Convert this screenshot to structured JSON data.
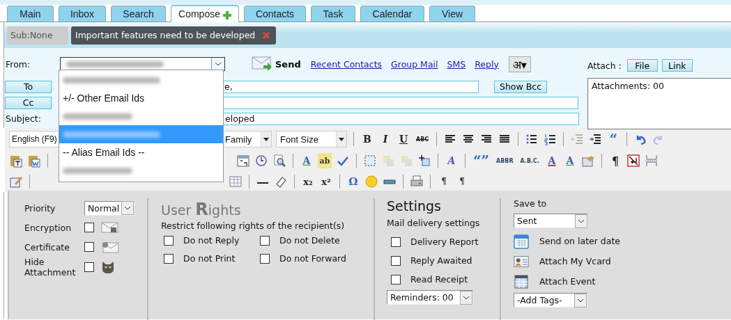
{
  "tabs": [
    {
      "label": "Main",
      "selected": false
    },
    {
      "label": "Inbox",
      "selected": false
    },
    {
      "label": "Search",
      "selected": false
    },
    {
      "label": "Compose",
      "selected": true,
      "add_icon": true
    },
    {
      "label": "Contacts",
      "selected": false
    },
    {
      "label": "Task",
      "selected": false
    },
    {
      "label": "Calendar",
      "selected": false
    },
    {
      "label": "View",
      "selected": false
    }
  ],
  "subject_bar": {
    "sub": "Sub:None",
    "chips": [
      {
        "label": "Important features need to be developed"
      }
    ]
  },
  "compose": {
    "from_label": "From:",
    "from_value_redacted": true,
    "send": "Send",
    "links": [
      "Recent Contacts",
      "Group Mail",
      "SMS",
      "Reply"
    ],
    "script_button": "अ▾",
    "attach_label": "Attach :",
    "attach_buttons": [
      "File",
      "Link"
    ],
    "attachments": "Attachments: 00",
    "to_button": "To",
    "to_value": "e,",
    "show_bcc": "Show Bcc",
    "cc_button": "Cc",
    "subject_label": "Subject:",
    "subject_value": "eloped"
  },
  "from_dropdown": [
    {
      "kind": "redacted",
      "selected": false
    },
    {
      "kind": "option",
      "label": "+/- Other Email Ids",
      "selected": false
    },
    {
      "kind": "redacted",
      "selected": false
    },
    {
      "kind": "redacted",
      "selected": true
    },
    {
      "kind": "option",
      "label": "-- Alias Email Ids --",
      "selected": false
    },
    {
      "kind": "redacted",
      "selected": false
    }
  ],
  "toolbar": [
    [
      {
        "kind": "select",
        "label": "English (F9)"
      },
      {
        "kind": "gap"
      },
      {
        "kind": "select",
        "label": "Family"
      },
      {
        "kind": "select",
        "label": "Font Size"
      },
      {
        "kind": "sep"
      },
      {
        "kind": "bold",
        "label": "B"
      },
      {
        "kind": "italic",
        "label": "I"
      },
      {
        "kind": "underline",
        "label": "U"
      },
      {
        "kind": "strike",
        "label": "ABC"
      },
      {
        "kind": "sep"
      },
      {
        "kind": "align-left"
      },
      {
        "kind": "align-center"
      },
      {
        "kind": "align-right"
      },
      {
        "kind": "align-justify"
      },
      {
        "kind": "sep"
      },
      {
        "kind": "bullet-list"
      },
      {
        "kind": "numbered-list"
      },
      {
        "kind": "sep"
      },
      {
        "kind": "outdent",
        "disabled": true
      },
      {
        "kind": "indent",
        "disabled": false
      },
      {
        "kind": "blockquote",
        "label": "“"
      },
      {
        "kind": "sep"
      },
      {
        "kind": "undo",
        "disabled": false
      },
      {
        "kind": "redo",
        "disabled": true
      }
    ],
    [
      {
        "kind": "paste-text"
      },
      {
        "kind": "paste-word"
      },
      {
        "kind": "sep"
      },
      {
        "kind": "gap"
      },
      {
        "kind": "date"
      },
      {
        "kind": "clock"
      },
      {
        "kind": "find"
      },
      {
        "kind": "sep"
      },
      {
        "kind": "text-color",
        "label": "A"
      },
      {
        "kind": "highlight",
        "label": "ab"
      },
      {
        "kind": "spellcheck"
      },
      {
        "kind": "sep"
      },
      {
        "kind": "select-all"
      },
      {
        "kind": "layers"
      },
      {
        "kind": "layers"
      },
      {
        "kind": "crop"
      },
      {
        "kind": "sep"
      },
      {
        "kind": "styles",
        "label": "A"
      },
      {
        "kind": "sep"
      },
      {
        "kind": "cite",
        "label": "“”"
      },
      {
        "kind": "abbr",
        "label": "ABBR"
      },
      {
        "kind": "acronym",
        "label": "A.B.C."
      },
      {
        "kind": "strike-letter",
        "label": "A"
      },
      {
        "kind": "underline-letter",
        "label": "A"
      },
      {
        "kind": "image-edit"
      },
      {
        "kind": "sep"
      },
      {
        "kind": "pilcrow",
        "label": "¶"
      },
      {
        "kind": "no-break"
      },
      {
        "kind": "page-break"
      }
    ],
    [
      {
        "kind": "pencil"
      },
      {
        "kind": "sep"
      },
      {
        "kind": "gap"
      },
      {
        "kind": "table"
      },
      {
        "kind": "sep"
      },
      {
        "kind": "line"
      },
      {
        "kind": "eraser"
      },
      {
        "kind": "sep"
      },
      {
        "kind": "subscript",
        "label": "x₂"
      },
      {
        "kind": "superscript",
        "label": "x²"
      },
      {
        "kind": "sep"
      },
      {
        "kind": "omega",
        "label": "Ω"
      },
      {
        "kind": "smiley"
      },
      {
        "kind": "rule"
      },
      {
        "kind": "sep"
      },
      {
        "kind": "print"
      },
      {
        "kind": "sep"
      },
      {
        "kind": "ltr",
        "label": "¶"
      },
      {
        "kind": "rtl",
        "label": "¶"
      }
    ]
  ],
  "options": {
    "priority": {
      "label": "Priority",
      "value": "Normal"
    },
    "security": [
      {
        "label": "Encryption",
        "checked": false,
        "kind": "lock"
      },
      {
        "label": "Certificate",
        "checked": false,
        "kind": "seal"
      },
      {
        "label": "Hide Attachment",
        "checked": false,
        "kind": "cat"
      }
    ],
    "rights": {
      "title": "User **R**ights",
      "subtitle": "Restrict following rights of the recipient(s)",
      "items": [
        {
          "label": "Do not Reply",
          "checked": false
        },
        {
          "label": "Do not Delete",
          "checked": false
        },
        {
          "label": "Do not Print",
          "checked": false
        },
        {
          "label": "Do not Forward",
          "checked": false
        }
      ]
    },
    "settings": {
      "title": "Settings",
      "subtitle": "Mail delivery settings",
      "items": [
        {
          "label": "Delivery Report",
          "checked": false
        },
        {
          "label": "Reply Awaited",
          "checked": false
        },
        {
          "label": "Read Receipt",
          "checked": false
        }
      ],
      "reminders": "Reminders: 00"
    },
    "save": {
      "label": "Save to",
      "value": "Sent",
      "actions": [
        {
          "kind": "calendar",
          "label": "Send on later date"
        },
        {
          "kind": "vcard",
          "label": "Attach My Vcard"
        },
        {
          "kind": "event",
          "label": "Attach Event"
        }
      ],
      "tags": "-Add Tags-"
    }
  }
}
